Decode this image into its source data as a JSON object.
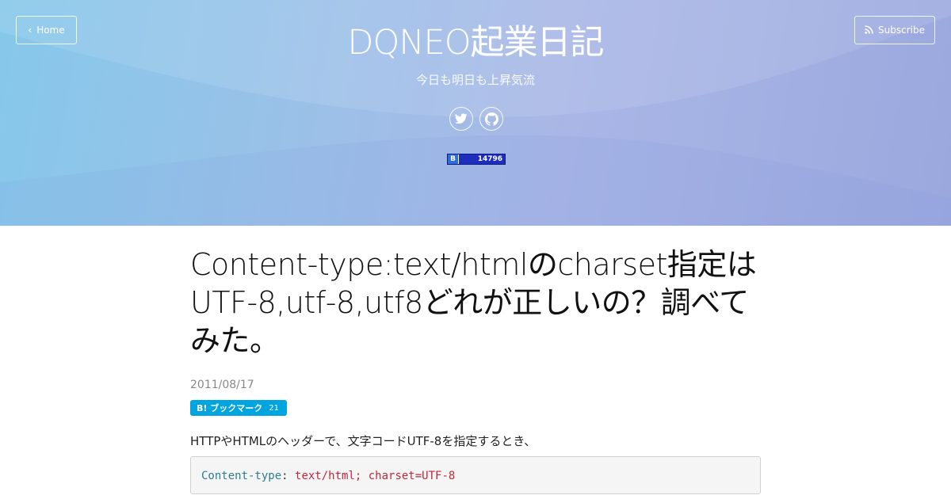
{
  "header": {
    "home_label": "Home",
    "subscribe_label": "Subscribe",
    "site_title": "DQNEO起業日記",
    "site_subtitle": "今日も明日も上昇気流",
    "social": [
      "twitter-icon",
      "github-icon"
    ],
    "hatena_counter": {
      "badge": "B",
      "count": "14796"
    }
  },
  "post": {
    "title": "Content-type:text/htmlのcharset指定はUTF-8,utf-8,utf8どれが正しいの？調べてみた。",
    "date": "2011/08/17",
    "bookmark": {
      "label": "B! ブックマーク",
      "count": "21"
    },
    "lead": "HTTPやHTMLのヘッダーで、文字コードUTF-8を指定するとき、",
    "code": {
      "key": "Content-type",
      "sep": ": ",
      "value": "text/html; charset=UTF-8"
    }
  },
  "colors": {
    "hero_start": "#86c8ea",
    "hero_end": "#9aa8de",
    "bookmark_blue": "#00a4de",
    "code_key": "#2a7f8a",
    "code_value": "#c0283e"
  }
}
